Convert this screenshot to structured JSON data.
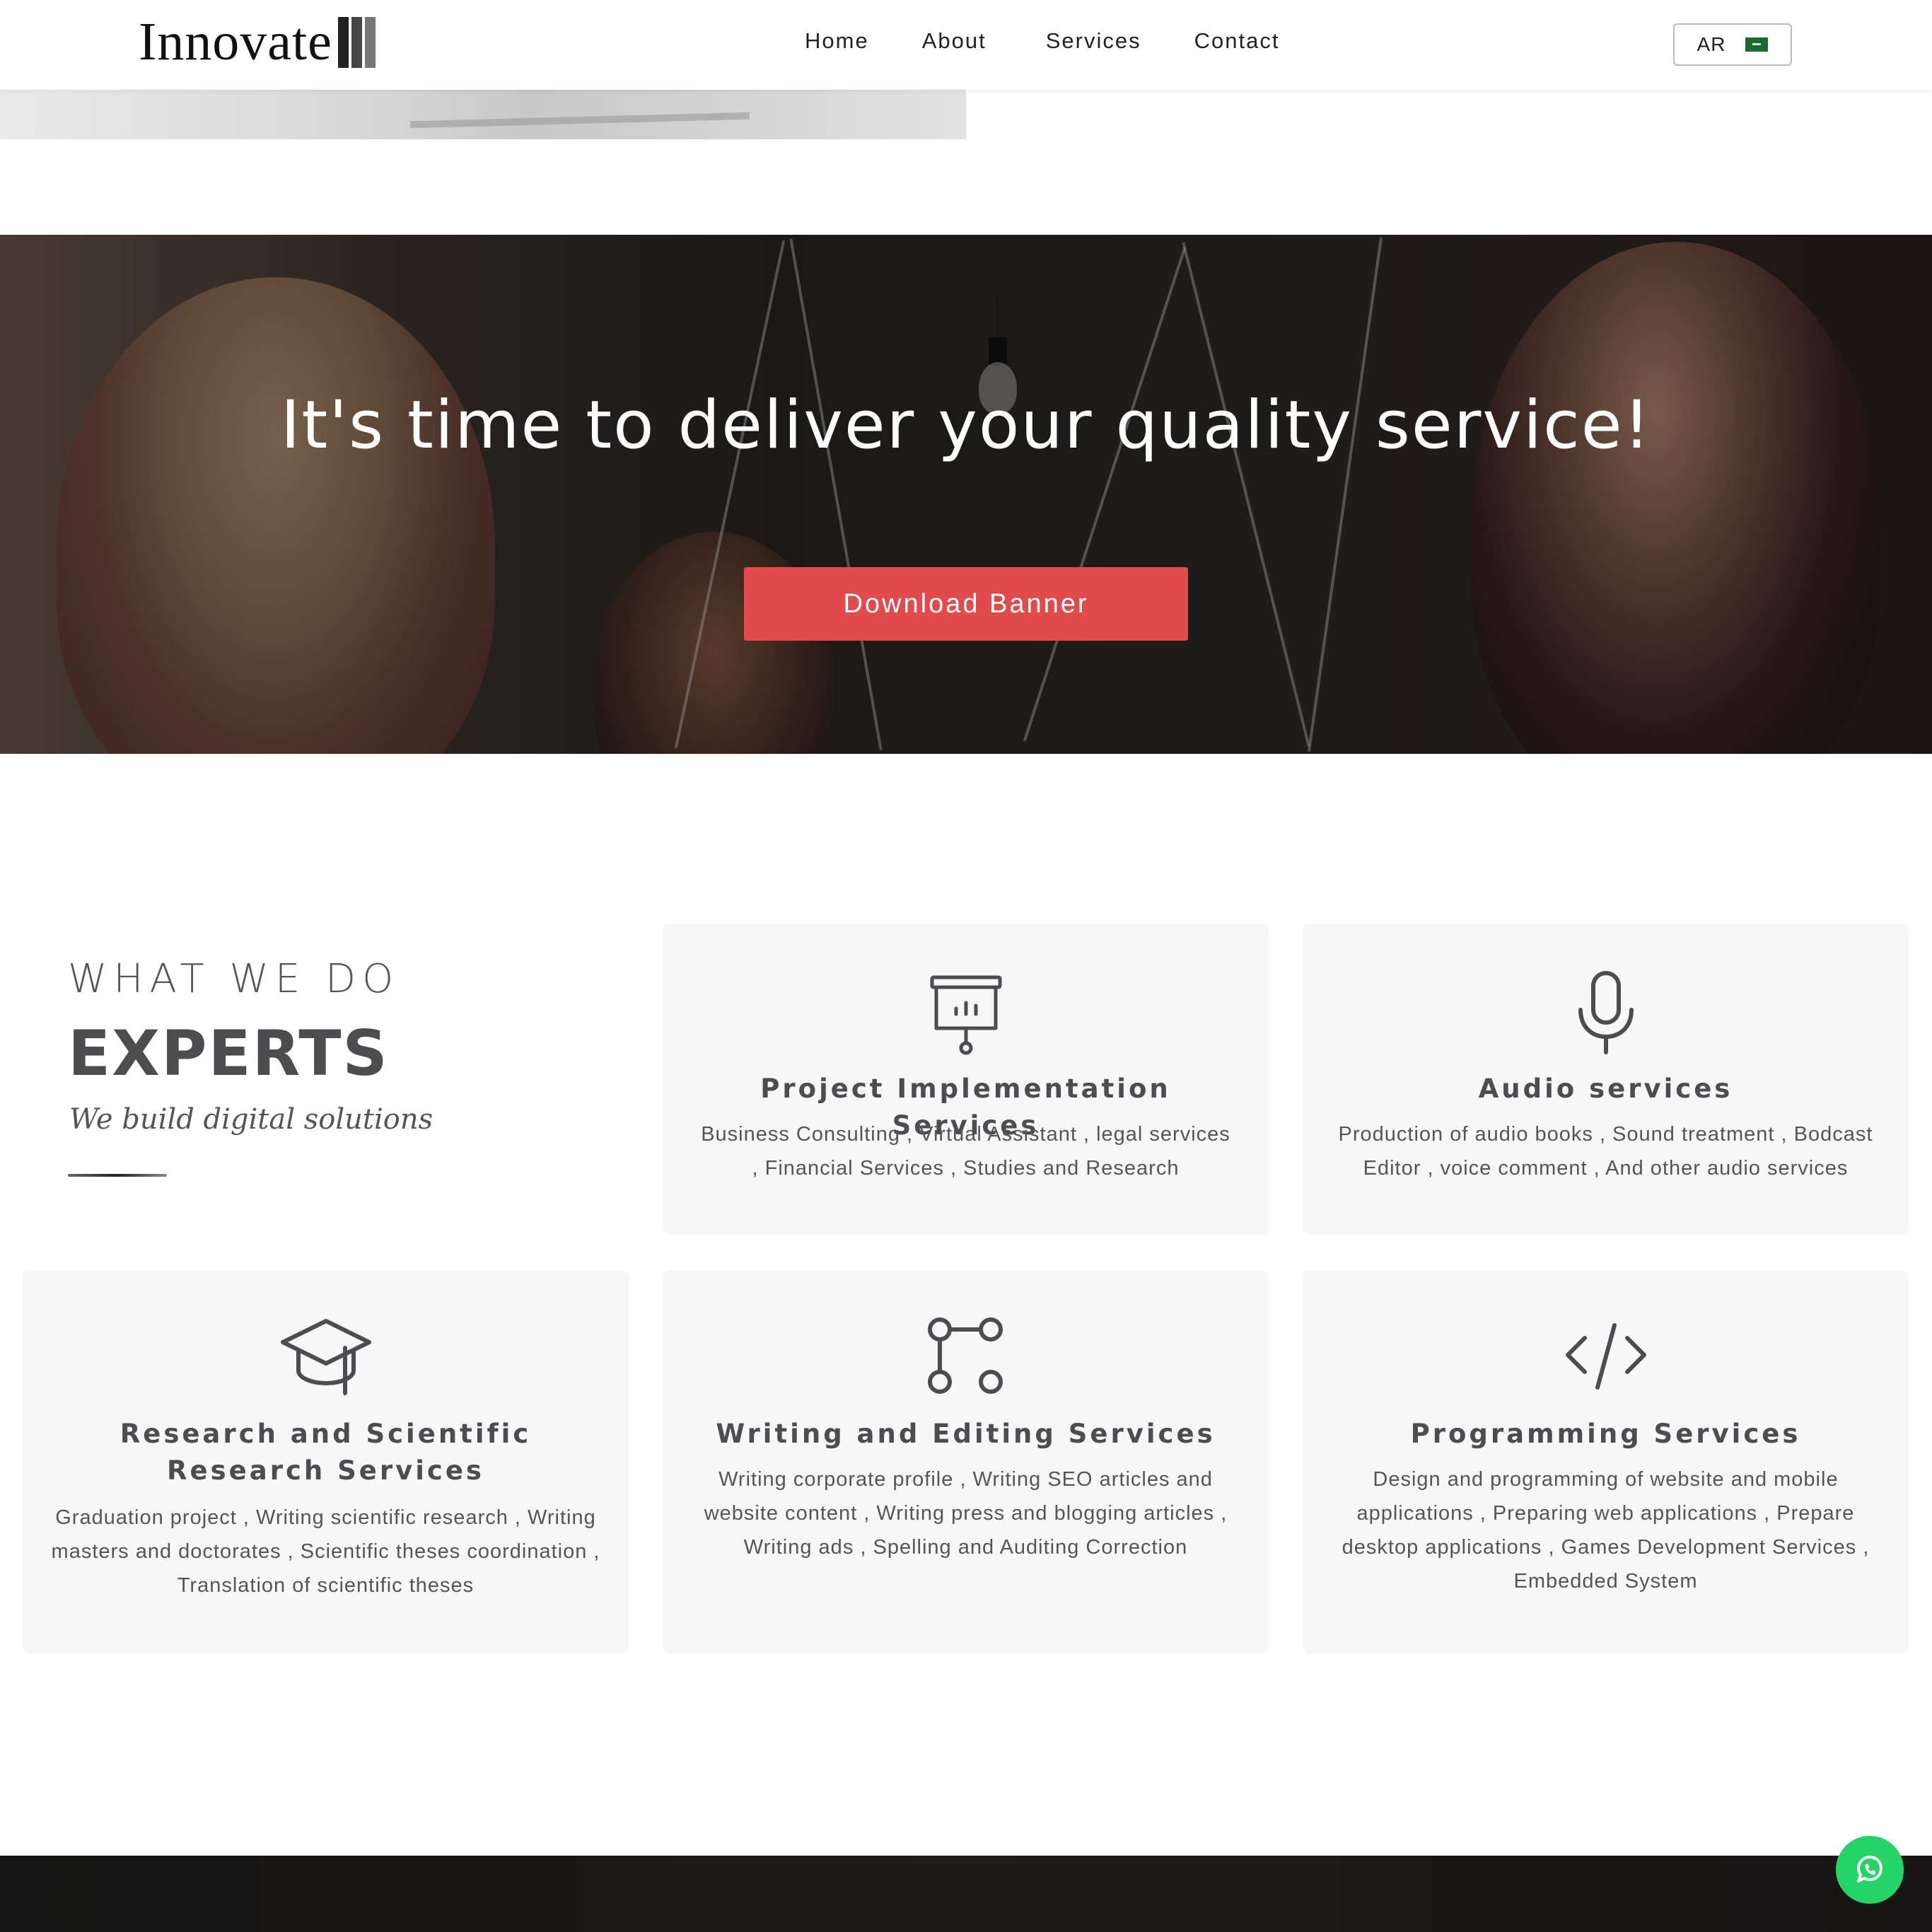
{
  "header": {
    "logo_text": "Innovate",
    "nav": [
      "Home",
      "About",
      "Services",
      "Contact"
    ],
    "lang_label": "AR",
    "logo_bar_colors": [
      "#222222",
      "#444444",
      "#777777"
    ]
  },
  "banner": {
    "title": "It's time to deliver your quality service!",
    "button_label": "Download Banner",
    "button_color": "#e24b4c"
  },
  "section": {
    "eyebrow": "WHAT WE DO",
    "headline": "EXPERTS",
    "tagline": "We build digital solutions"
  },
  "services": [
    {
      "icon": "presentation-board-icon",
      "title": "Project Implementation Services",
      "desc": "Business Consulting , Virtual Assistant , legal services , Financial Services , Studies and Research"
    },
    {
      "icon": "microphone-icon",
      "title": "Audio services",
      "desc": "Production of audio books , Sound treatment , Bodcast Editor , voice comment , And other audio services"
    },
    {
      "icon": "graduation-cap-icon",
      "title": "Research and Scientific Research Services",
      "desc": "Graduation project , Writing scientific research , Writing masters and doctorates , Scientific theses coordination , Translation of scientific theses"
    },
    {
      "icon": "git-branch-icon",
      "title": "Writing and Editing Services",
      "desc": "Writing corporate profile , Writing SEO articles and website content , Writing press and blogging articles , Writing ads , Spelling and Auditing Correction"
    },
    {
      "icon": "code-icon",
      "title": "Programming Services",
      "desc": "Design and programming of website and mobile applications , Preparing web applications , Prepare desktop applications , Games Development Services , Embedded System"
    }
  ],
  "floating": {
    "whatsapp_icon": "whatsapp-icon",
    "whatsapp_color": "#25d366"
  }
}
